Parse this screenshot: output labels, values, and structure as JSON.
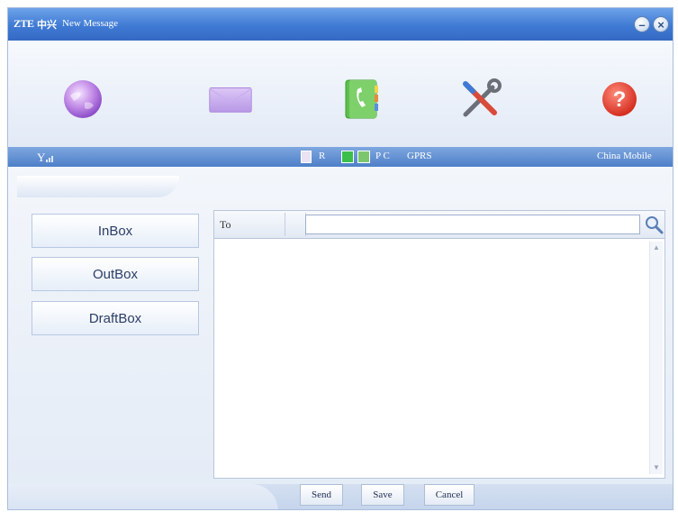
{
  "window": {
    "logo": "ZTE",
    "logo_cn": "中兴",
    "title": "New Message",
    "minimize_label": "–",
    "close_label": "×"
  },
  "toolbar": {
    "items": [
      {
        "icon": "globe-icon"
      },
      {
        "icon": "envelope-icon"
      },
      {
        "icon": "phonebook-icon"
      },
      {
        "icon": "tools-icon"
      },
      {
        "icon": "help-icon"
      }
    ]
  },
  "statusbar": {
    "signal_icon": "signal-icon",
    "roaming": "R",
    "pc": "P C",
    "network_type": "GPRS",
    "operator": "China Mobile"
  },
  "nav": {
    "inbox": "InBox",
    "outbox": "OutBox",
    "draftbox": "DraftBox"
  },
  "message": {
    "to_label": "To",
    "to_value": "",
    "body": ""
  },
  "actions": {
    "send": "Send",
    "save": "Save",
    "cancel": "Cancel"
  }
}
